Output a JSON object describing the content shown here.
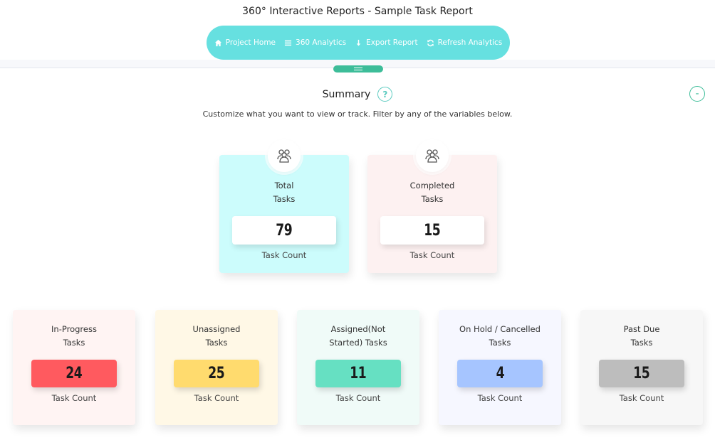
{
  "app": {
    "title": "360° Interactive Reports - Sample Task Report"
  },
  "nav": [
    {
      "label": "Project Home",
      "icon": "home-icon"
    },
    {
      "label": "360 Analytics",
      "icon": "list-icon"
    },
    {
      "label": "Export Report",
      "icon": "download-arrow-icon"
    },
    {
      "label": "Refresh Analytics",
      "icon": "refresh-icon"
    }
  ],
  "summary": {
    "title": "Summary",
    "help": "?",
    "collapse": "-",
    "subtitle": "Customize what you want to view or track. Filter by any of the variables below."
  },
  "cards_top": [
    {
      "line1": "Total",
      "line2": "Tasks",
      "value": "79",
      "sub": "Task Count",
      "bg": "#ccfcfc",
      "icon": "users-group-icon"
    },
    {
      "line1": "Completed",
      "line2": "Tasks",
      "value": "15",
      "sub": "Task Count",
      "bg": "#fdf1f1",
      "icon": "users-group-icon"
    }
  ],
  "cards_bottom": [
    {
      "line1": "In-Progress",
      "line2": "Tasks",
      "value": "24",
      "sub": "Task Count",
      "bg": "#fff4f3",
      "accent": "#ff5a5f"
    },
    {
      "line1": "Unassigned",
      "line2": "Tasks",
      "value": "25",
      "sub": "Task Count",
      "bg": "#fff8e6",
      "accent": "#ffdb6e"
    },
    {
      "line1": "Assigned(Not",
      "line2": "Started) Tasks",
      "value": "11",
      "sub": "Task Count",
      "bg": "#f0fbf8",
      "accent": "#66e0c2"
    },
    {
      "line1": "On Hold / Cancelled",
      "line2": "Tasks",
      "value": "4",
      "sub": "Task Count",
      "bg": "#f6f7ff",
      "accent": "#a6c5ff"
    },
    {
      "line1": "Past Due",
      "line2": "Tasks",
      "value": "15",
      "sub": "Task Count",
      "bg": "#f7f7f7",
      "accent": "#bdbdbd"
    }
  ]
}
